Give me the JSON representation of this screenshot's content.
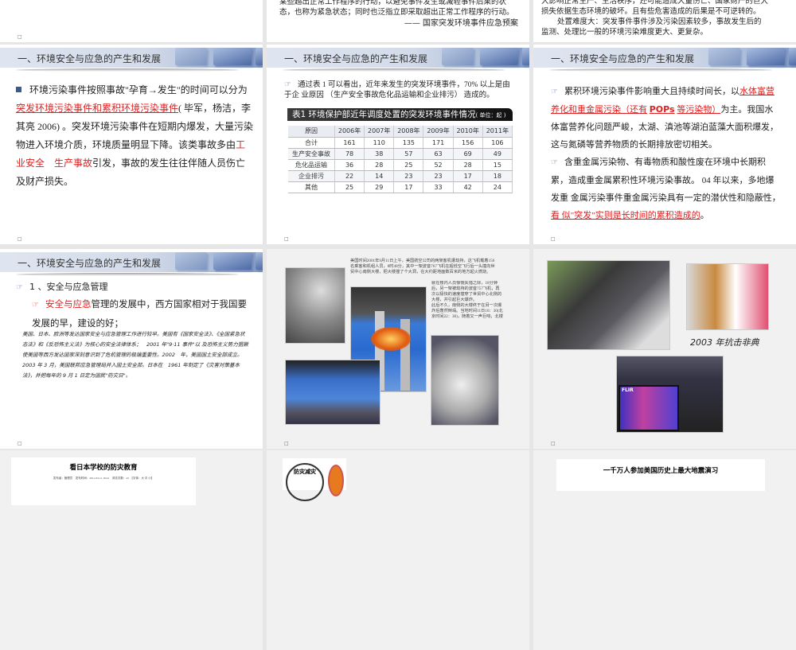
{
  "marker": "□",
  "slides": {
    "top_left": {
      "marker": "□"
    },
    "top_mid": {
      "line1": "某些超出正常工作程序的行动，以避免事件发生或减轻事件后果的状",
      "line2": "态，也称为紧急状态；同时也泛指立即采取超出正常工作程序的行动。",
      "source": "—— 国家突发环境事件应急预案"
    },
    "top_right": {
      "line1": "大影响正常生产、生活秩序，还可能造成大量伤亡、国家财产的巨大",
      "line2": "损失依据生态环境的破坏。且有些危害造成的后果是不可逆转的。",
      "line3": "处置难度大：突发事件事件涉及污染因素较多，事故发生后的",
      "line4": "监测、处理比一般的环境污染难度更大、更复杂。"
    },
    "s1": {
      "header": "一、环境安全与应急的产生和发展",
      "p1": "环境污染事件按照事故\"孕育→发生\"的时间可以分为",
      "p1_link": "突发环境污染事件和累积环境污染事件",
      "p2": "( 毕军，杨洁，李其亮 2006) 。突发环境污染事件在短期内爆发，大量污染物进入环境介质，环境质量明显下降。该类事故多由",
      "p2_red": "工业安全　生产事故",
      "p3": "引发，事故的发生往往伴随人员伤亡及财产损失。"
    },
    "s2": {
      "header": "一、环境安全与应急的产生和发展",
      "intro": "通过表 1 可以看出，近年来发生的突发环境事件，70% 以上是由于企 业原因 （生产安全事故危化品运输和企业排污） 造成的。",
      "table_title": "表1  环境保护部近年调度处置的突发环境事件情况",
      "table_unit": "( 单位：起 )",
      "columns": [
        "原因",
        "2006年",
        "2007年",
        "2008年",
        "2009年",
        "2010年",
        "2011年"
      ],
      "rows": [
        [
          "合计",
          "161",
          "110",
          "135",
          "171",
          "156",
          "106"
        ],
        [
          "生产安全事故",
          "78",
          "38",
          "57",
          "63",
          "69",
          "49"
        ],
        [
          "危化品运输",
          "36",
          "28",
          "25",
          "52",
          "28",
          "15"
        ],
        [
          "企业排污",
          "22",
          "14",
          "23",
          "23",
          "17",
          "18"
        ],
        [
          "其他",
          "25",
          "29",
          "17",
          "33",
          "42",
          "24"
        ]
      ]
    },
    "s3": {
      "header": "一、环境安全与应急的产生和发展",
      "b1_a": "累积环境污染事件影响重大且持续时间长，以",
      "b1_link1": "水体富营养化和重金属污染（还有",
      "b1_pops": "POPs",
      "b1_link2": "等污染物）",
      "b1_b": "为主。我国水体富营养化问题严峻，太湖、滇池等湖泊蓝藻大面积爆发，这与氮磷等营养物质的长期排放密切相关。",
      "b2_a": "含重金属污染物、有毒物质和酸性废在环境中长期积累，造成重金属累积性环境污染事故。 04 年以来，多地爆发重 金属污染事件重金属污染具有一定的潜伏性和隐蔽性，",
      "b2_link": "看 似\"突发\"实则是长时间的累积造成的",
      "b2_end": "。"
    },
    "s4": {
      "header": "一、环境安全与应急的产生和发展",
      "item1": "1 、安全与应急管理",
      "item2_red": "安全与应急",
      "item2": "管理的发展中，西方国家相对于我国要发展的早，建设的好；",
      "note": "美国、日本、欧洲等发达国家安全与应急管理工作进行较早。美国有《国家安全法》、《全国紧急状态法》和《反恐怖主义法》为核心的安全法律体系；　2001 年\"9·11 事件\"以 及恐怖主义势力猖獗使美国等西方发达国家深刻意识到了危机管理的极端重要性。2002　年，美国国土安全部成立。2003 年 3 月，美国联邦应急管理局并入国土安全部。日本在　1961 年制定了《灾害对策基本法》，并把每年的 9 月 1 日定为国民\"防灾日\"。"
    },
    "s5": {
      "text1": "美国时间2001年9月11日上午，美国航空公司的两架客机遭劫持，这飞机载着156名乘客和机组人员，8时48分，其中一架波音767飞机在超低空飞行后一头撞向世贸中心南侧大楼，把大楼撞了个大洞，在大约距地面数百米的地方起火燃烧。",
      "text2": "就在楼内人员惊慌失措之际，18分钟后，另一架被劫持的波音757飞机，再次以极快的速度撞穿了世贸中心北侧的大楼，并引起巨大爆炸。",
      "text3": "此后不久，南侧的大楼终于在另一次爆炸后轰然倒塌。当地时间11日10：30(北京时间22：30)，随着又一声巨响，北楼也在爆炸中成为另一片废墟，闻名世界的纽约世贸中心不复存在。"
    },
    "s6": {
      "caption": "2003 年抗击非典",
      "thermal_brand": "FLIR"
    },
    "s7": {
      "title": "看日本学校的防灾教育",
      "meta": "发布者：管理员　发布时间：2011-03-11 16:41　浏览次数：43　【字体：大 中 小】"
    },
    "s8": {
      "logo_text": "防灾减灾"
    },
    "s9": {
      "title": "一千万人参加美国历史上最大地震演习"
    }
  },
  "colors": {
    "accent_red": "#e02020",
    "header_blue": "#7f98c4",
    "table_header": "#111111"
  }
}
